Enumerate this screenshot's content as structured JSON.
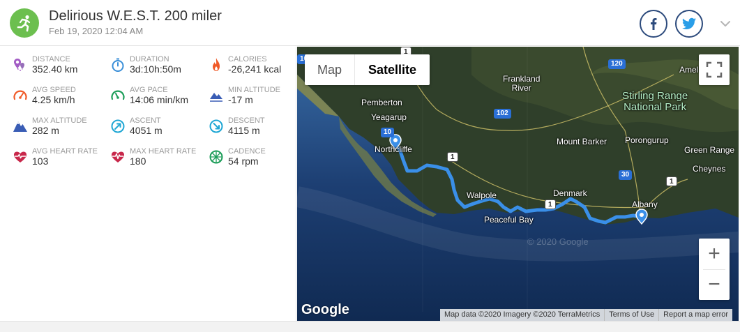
{
  "header": {
    "title": "Delirious W.E.S.T. 200 miler",
    "date": "Feb 19, 2020 12:04 AM"
  },
  "stats": [
    {
      "label": "DISTANCE",
      "value": "352.40 km",
      "icon": "distance-pin-icon",
      "color": "#a25bc4"
    },
    {
      "label": "DURATION",
      "value": "3d:10h:50m",
      "icon": "stopwatch-icon",
      "color": "#3a8fd8"
    },
    {
      "label": "CALORIES",
      "value": "-26,241 kcal",
      "icon": "flame-icon",
      "color": "#f05a28"
    },
    {
      "label": "AVG SPEED",
      "value": "4.25 km/h",
      "icon": "speedometer-icon",
      "color": "#f05a28"
    },
    {
      "label": "AVG PACE",
      "value": "14:06 min/km",
      "icon": "pace-gauge-icon",
      "color": "#1e9e5a"
    },
    {
      "label": "MIN ALTITUDE",
      "value": "-17 m",
      "icon": "mountain-low-icon",
      "color": "#3a5db5"
    },
    {
      "label": "MAX ALTITUDE",
      "value": "282 m",
      "icon": "mountain-high-icon",
      "color": "#3a5db5"
    },
    {
      "label": "ASCENT",
      "value": "4051 m",
      "icon": "ascent-icon",
      "color": "#1ea6d4"
    },
    {
      "label": "DESCENT",
      "value": "4115 m",
      "icon": "descent-icon",
      "color": "#1ea6d4"
    },
    {
      "label": "AVG HEART RATE",
      "value": "103",
      "icon": "heart-rate-icon",
      "color": "#c8284b"
    },
    {
      "label": "MAX HEART RATE",
      "value": "180",
      "icon": "heart-rate-max-icon",
      "color": "#c8284b"
    },
    {
      "label": "CADENCE",
      "value": "54 rpm",
      "icon": "cadence-wheel-icon",
      "color": "#1e9e5a"
    }
  ],
  "map": {
    "type_map": "Map",
    "type_satellite": "Satellite",
    "zoom_in": "+",
    "zoom_out": "−",
    "google": "Google",
    "watermark": "© 2020 Google",
    "attribution": "Map data ©2020 Imagery ©2020 TerraMetrics",
    "terms": "Terms of Use",
    "report": "Report a map error",
    "labels": {
      "pemberton": "Pemberton",
      "yeagarup": "Yeagarup",
      "northcliffe": "Northcliffe",
      "frankland": "Frankland\nRiver",
      "walpole": "Walpole",
      "peaceful_bay": "Peaceful Bay",
      "denmark": "Denmark",
      "mount_barker": "Mount Barker",
      "porongurup": "Porongurup",
      "albany": "Albany",
      "green_range": "Green Range",
      "cheynes": "Cheynes",
      "amelup": "Amel",
      "stirling": "Stirling Range\nNational Park"
    },
    "shields": {
      "r1a": "1",
      "r1b": "1",
      "r1c": "1",
      "r1d": "1",
      "r10": "10",
      "r10b": "10",
      "r102": "102",
      "r120": "120",
      "r30": "30"
    }
  },
  "colors": {
    "accent_green": "#6cbf4f",
    "social_navy": "#2c4a7c",
    "route_blue": "#3a8fe8"
  }
}
